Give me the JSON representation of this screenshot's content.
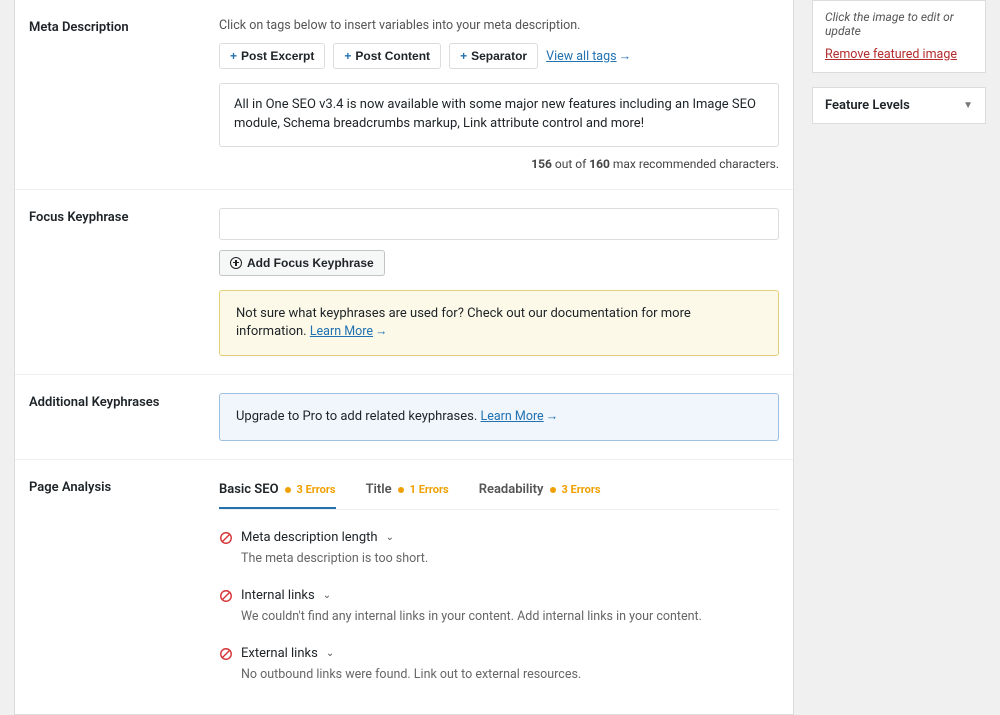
{
  "meta_description": {
    "label": "Meta Description",
    "hint": "Click on tags below to insert variables into your meta description.",
    "tags": {
      "post_excerpt": "Post Excerpt",
      "post_content": "Post Content",
      "separator": "Separator"
    },
    "view_all": "View all tags",
    "value": "All in One SEO v3.4 is now available with some major new features including an Image SEO module, Schema breadcrumbs markup, Link attribute control and more!",
    "charcount": {
      "current": "156",
      "mid": " out of ",
      "max": "160",
      "suffix": " max recommended characters."
    }
  },
  "focus_keyphrase": {
    "label": "Focus Keyphrase",
    "add_btn": "Add Focus Keyphrase",
    "notice_pre": "Not sure what keyphrases are used for? Check out our documentation for more information. ",
    "learn_more": "Learn More"
  },
  "additional_keyphrases": {
    "label": "Additional Keyphrases",
    "notice_pre": "Upgrade to Pro to add related keyphrases. ",
    "learn_more": "Learn More"
  },
  "page_analysis": {
    "label": "Page Analysis",
    "tabs": {
      "basic": {
        "label": "Basic SEO",
        "errors": "3 Errors"
      },
      "title": {
        "label": "Title",
        "errors": "1 Errors"
      },
      "readability": {
        "label": "Readability",
        "errors": "3 Errors"
      }
    },
    "items": [
      {
        "title": "Meta description length",
        "desc": "The meta description is too short."
      },
      {
        "title": "Internal links",
        "desc": "We couldn't find any internal links in your content. Add internal links in your content."
      },
      {
        "title": "External links",
        "desc": "No outbound links were found. Link out to external resources."
      }
    ]
  },
  "sidebar": {
    "featured_hint": "Click the image to edit or update",
    "remove_featured": "Remove featured image",
    "feature_levels": "Feature Levels"
  }
}
